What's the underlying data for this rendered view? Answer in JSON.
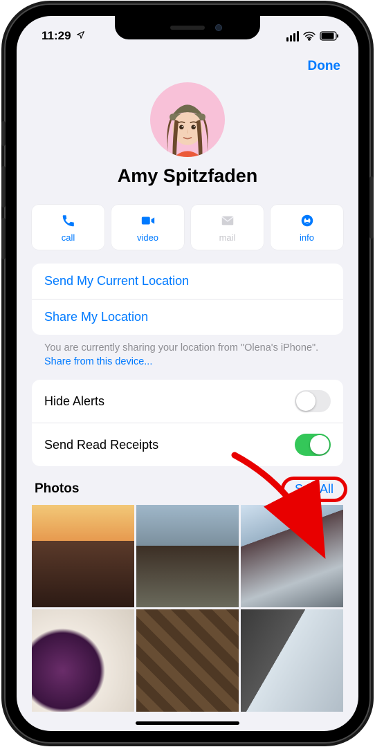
{
  "statusbar": {
    "time": "11:29"
  },
  "navbar": {
    "done": "Done"
  },
  "contact": {
    "name": "Amy Spitzfaden"
  },
  "actions": {
    "call": "call",
    "video": "video",
    "mail": "mail",
    "info": "info"
  },
  "location_group": {
    "send_current": "Send My Current Location",
    "share": "Share My Location"
  },
  "location_footer": {
    "prefix": "You are currently sharing your location from \"Olena's iPhone\". ",
    "link": "Share from this device..."
  },
  "settings_group": {
    "hide_alerts": {
      "label": "Hide Alerts",
      "value": false
    },
    "read_receipts": {
      "label": "Send Read Receipts",
      "value": true
    }
  },
  "photos": {
    "title": "Photos",
    "see_all": "See All"
  }
}
